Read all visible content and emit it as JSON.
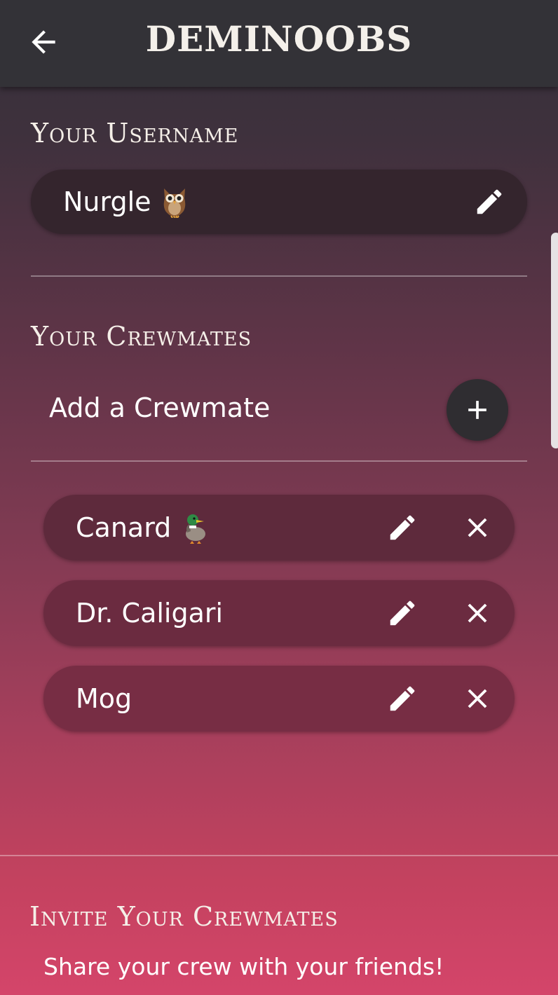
{
  "app": {
    "title": "DEMINOOBS"
  },
  "username_section": {
    "title": "Your Username",
    "username": "Nurgle",
    "emoji": "owl-emoji"
  },
  "crew_section": {
    "title": "Your Crewmates",
    "add_label": "Add a Crewmate",
    "crewmates": [
      {
        "name": "Canard",
        "emoji": "duck-emoji"
      },
      {
        "name": "Dr. Caligari",
        "emoji": ""
      },
      {
        "name": "Mog",
        "emoji": ""
      }
    ]
  },
  "invite_section": {
    "title": "Invite Your Crewmates",
    "subtitle": "Share your crew with your friends!"
  },
  "colors": {
    "appbar": "#333237",
    "username_pill": "#34252d",
    "crew_pill_1": "#5e2a3c",
    "crew_pill_2": "#6b2b40",
    "crew_pill_3": "#772d44",
    "add_button": "#2f2d31"
  },
  "icons": {
    "back": "arrow-left-icon",
    "edit": "pencil-icon",
    "remove": "close-icon",
    "add": "plus-icon"
  }
}
